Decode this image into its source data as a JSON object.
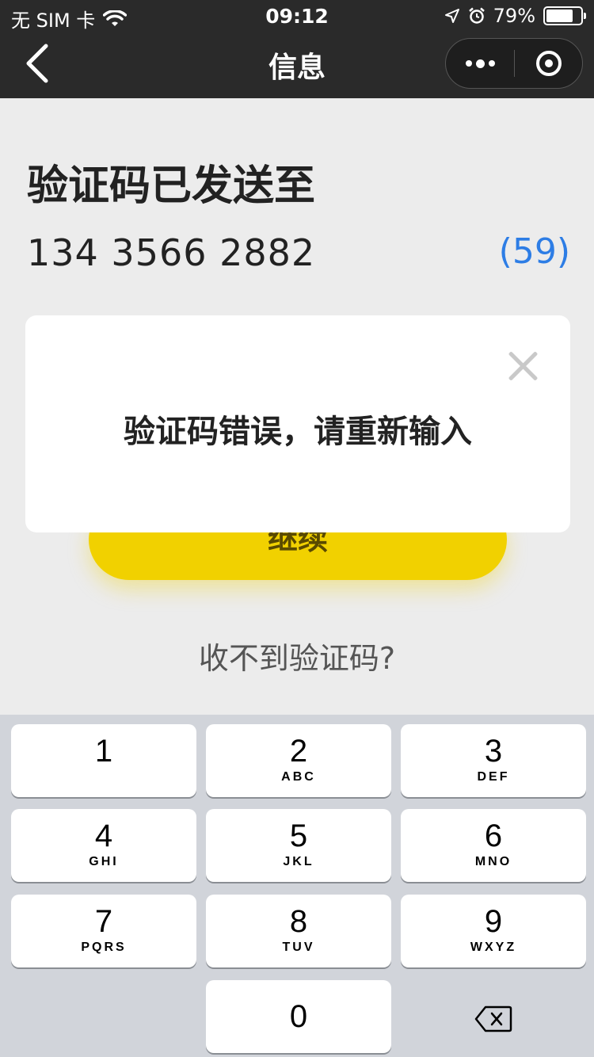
{
  "status_bar": {
    "carrier": "无 SIM 卡",
    "time": "09:12",
    "battery_percent": "79%",
    "battery_level": 0.79,
    "icons": [
      "wifi-icon",
      "location-arrow-icon",
      "alarm-icon",
      "battery-icon"
    ]
  },
  "nav": {
    "title": "信息",
    "back_icon": "chevron-left-icon",
    "more_icon": "more-dots-icon",
    "close_icon": "target-circle-icon"
  },
  "content": {
    "headline": "验证码已发送至",
    "phone": "134 3566 2882",
    "countdown": "(59)",
    "continue_label": "继续",
    "no_code_link": "收不到验证码?"
  },
  "modal": {
    "message": "验证码错误，请重新输入",
    "close_icon": "close-icon"
  },
  "keypad": {
    "keys": [
      {
        "num": "1",
        "letters": ""
      },
      {
        "num": "2",
        "letters": "ABC"
      },
      {
        "num": "3",
        "letters": "DEF"
      },
      {
        "num": "4",
        "letters": "GHI"
      },
      {
        "num": "5",
        "letters": "JKL"
      },
      {
        "num": "6",
        "letters": "MNO"
      },
      {
        "num": "7",
        "letters": "PQRS"
      },
      {
        "num": "8",
        "letters": "TUV"
      },
      {
        "num": "9",
        "letters": "WXYZ"
      },
      {
        "num": "0",
        "letters": ""
      }
    ],
    "delete_icon": "backspace-icon"
  },
  "colors": {
    "nav_background": "#2a2a2a",
    "accent_yellow": "#f1d100",
    "countdown_blue": "#2d7de5",
    "page_background": "#ececec",
    "keypad_background": "#d1d4da"
  }
}
